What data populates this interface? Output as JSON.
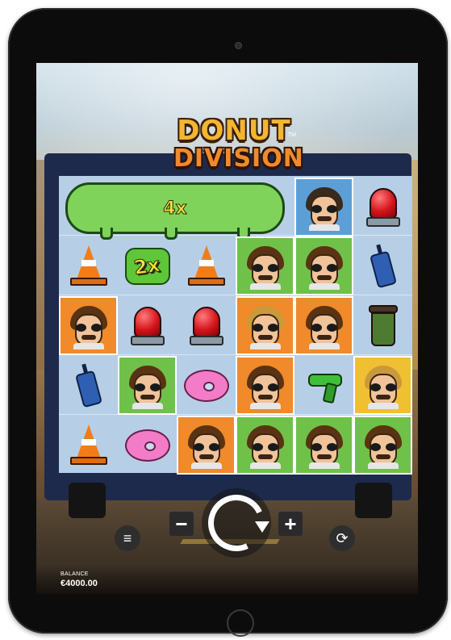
{
  "game": {
    "logo_top": "DONUT",
    "logo_bottom": "DIVISION",
    "trademark": "TM"
  },
  "reels": {
    "wild_multiplier": "4x",
    "multiplier_symbol": "2x",
    "rows": [
      [
        "wild",
        "wild",
        "wild",
        "wild",
        "cop-sunglasses",
        "siren"
      ],
      [
        "cone",
        "multiplier-2x",
        "cone",
        "detective-brown",
        "detective-brown",
        "radio"
      ],
      [
        "detective-brown",
        "siren",
        "siren",
        "detective-blond",
        "detective-brown",
        "coffee-cup"
      ],
      [
        "radio",
        "detective-brown",
        "donut",
        "detective-brown",
        "green-gun",
        "detective-blond"
      ],
      [
        "cone",
        "donut",
        "detective-brown",
        "detective-brown",
        "detective-brown",
        "detective-brown"
      ]
    ]
  },
  "controls": {
    "minus_label": "−",
    "plus_label": "+",
    "menu_icon": "≡",
    "autoplay_icon": "⟳"
  },
  "balance": {
    "label": "BALANCE",
    "value": "€4000.00"
  },
  "colors": {
    "tablet_frame": "#0c0c0c",
    "reel_bg": "#b7cfe6",
    "frame_green": "#6fc14a",
    "frame_orange": "#f08a2a",
    "frame_blue": "#5b9fd6",
    "frame_yellow": "#f1c032"
  }
}
